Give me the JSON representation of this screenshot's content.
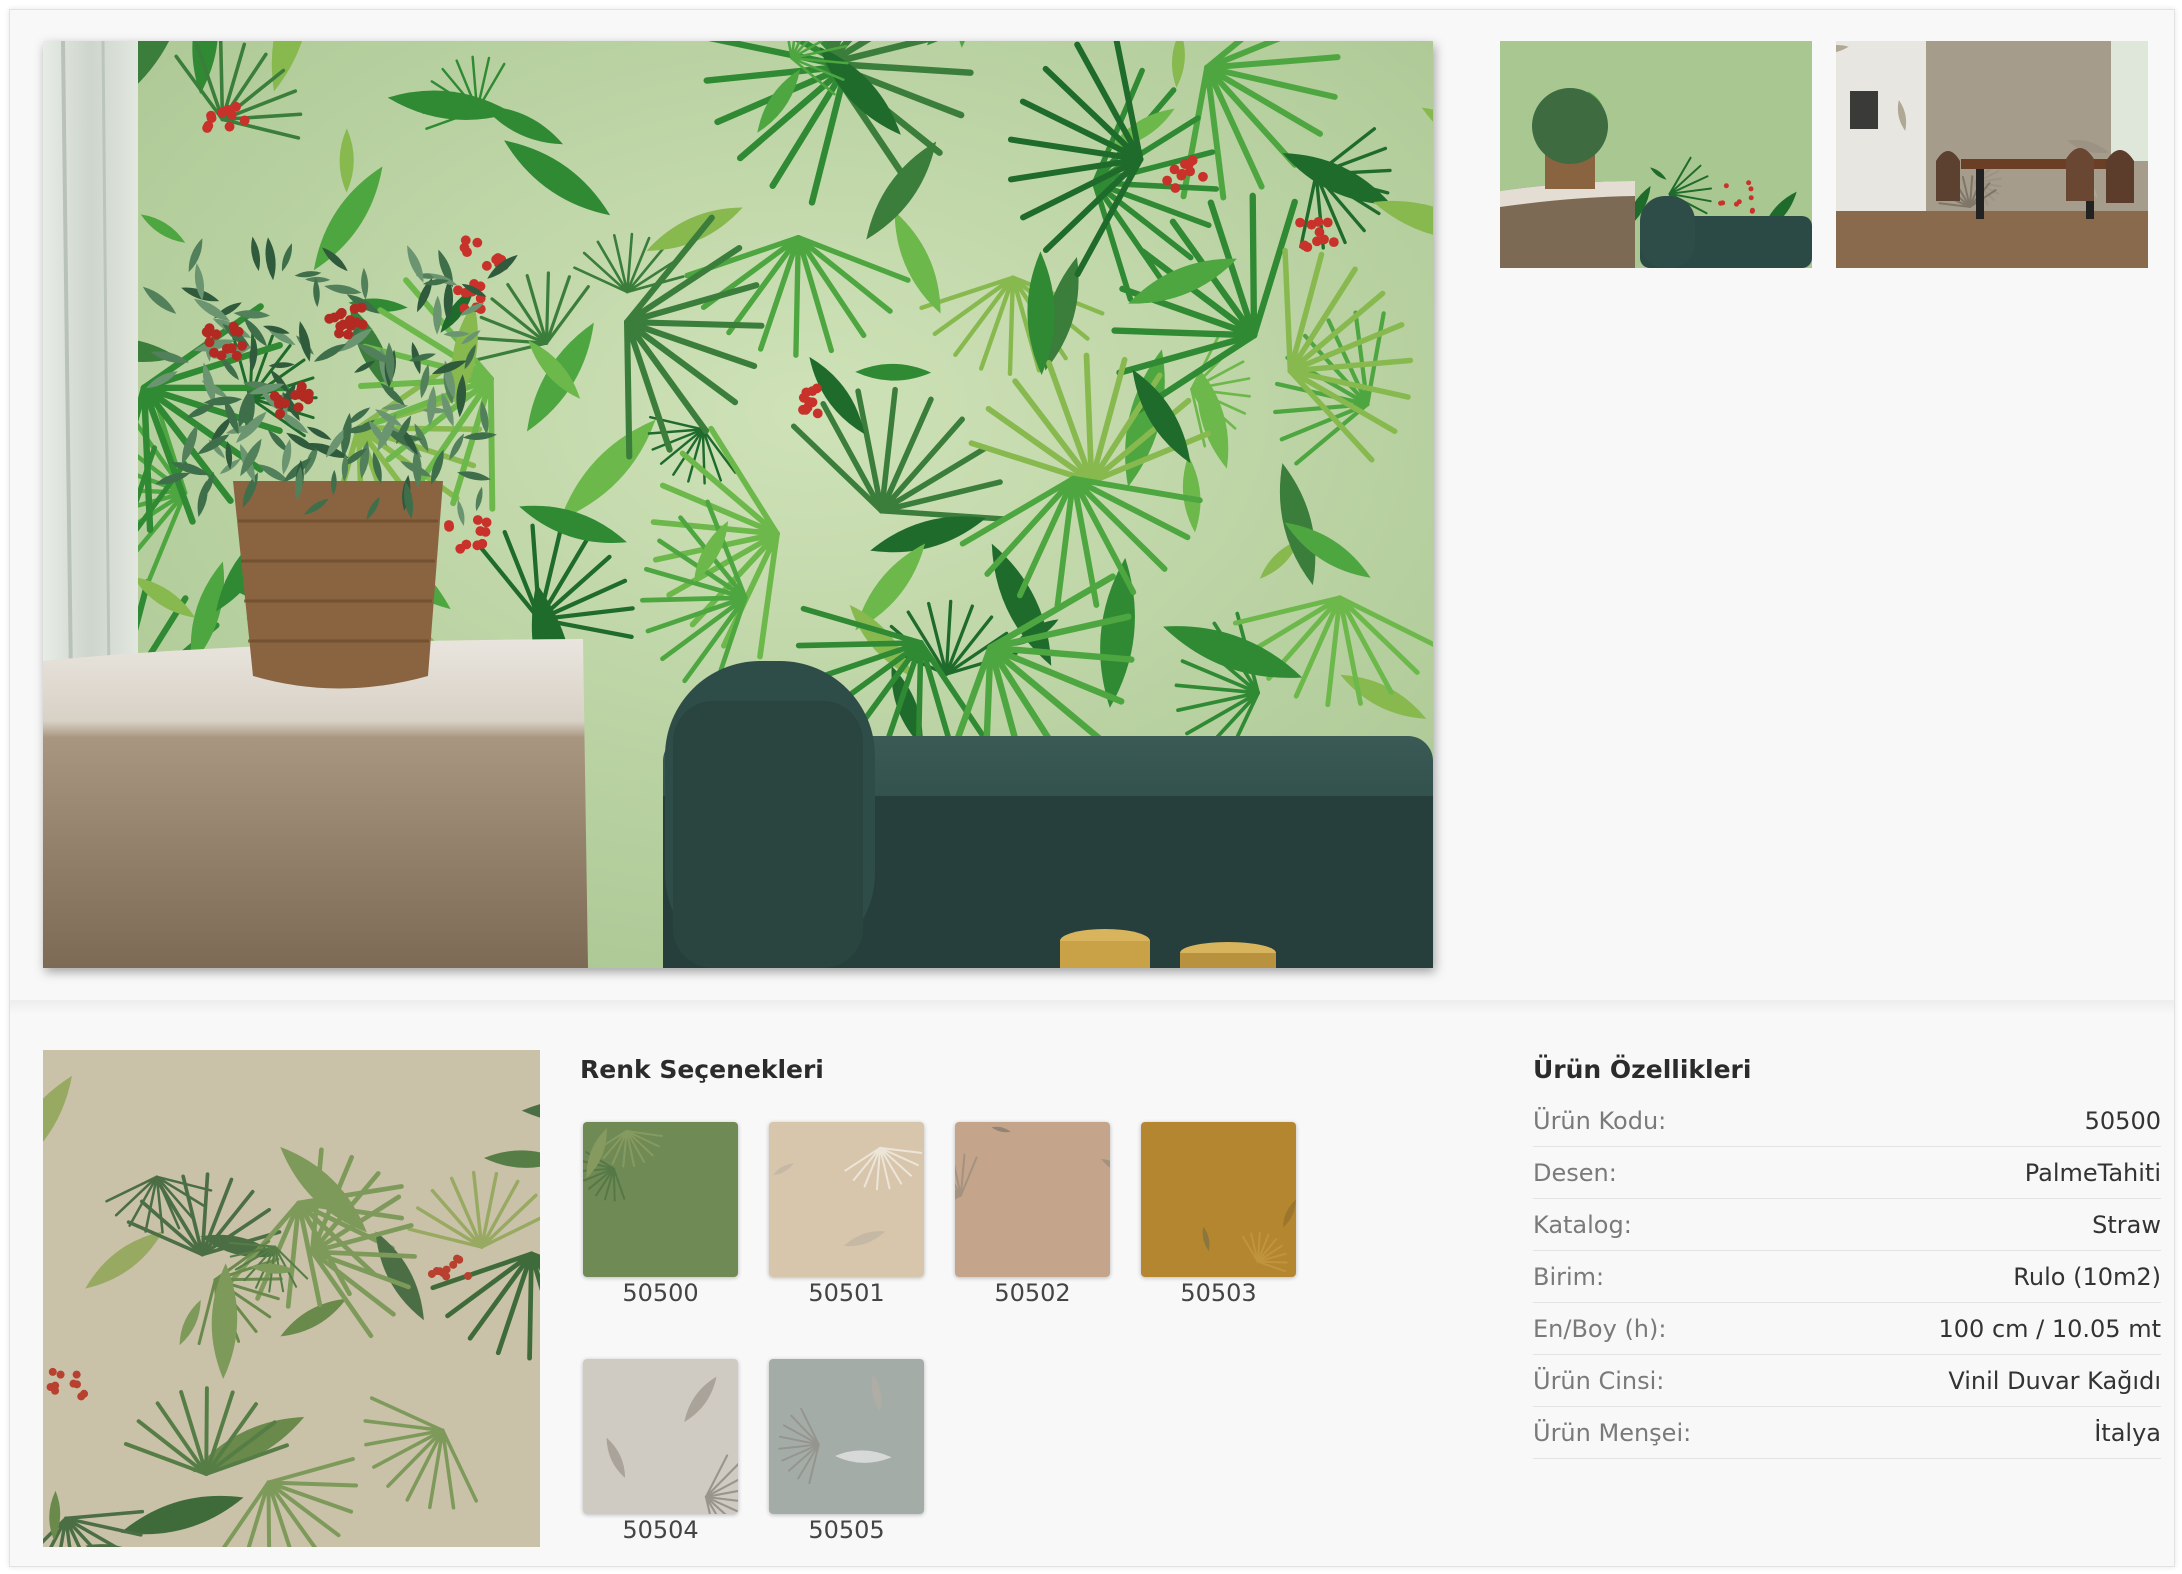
{
  "thumbnails": [
    {
      "alt": "room-scene-1"
    },
    {
      "alt": "room-scene-2"
    }
  ],
  "colors_section": {
    "title": "Renk Seçenekleri",
    "options": [
      {
        "code": "50500",
        "tone": "#6f8a55"
      },
      {
        "code": "50501",
        "tone": "#d7c6ac"
      },
      {
        "code": "50502",
        "tone": "#c4a58b"
      },
      {
        "code": "50503",
        "tone": "#b4862f"
      },
      {
        "code": "50504",
        "tone": "#cfcac2"
      },
      {
        "code": "50505",
        "tone": "#a4aca8"
      }
    ]
  },
  "properties_section": {
    "title": "Ürün Özellikleri",
    "rows": [
      {
        "key": "Ürün Kodu:",
        "value": "50500"
      },
      {
        "key": "Desen:",
        "value": "PalmeTahiti"
      },
      {
        "key": "Katalog:",
        "value": "Straw"
      },
      {
        "key": "Birim:",
        "value": "Rulo (10m2)"
      },
      {
        "key": "En/Boy (h):",
        "value": "100 cm / 10.05 mt"
      },
      {
        "key": "Ürün Cinsi:",
        "value": "Vinil Duvar Kağıdı"
      },
      {
        "key": "Ürün Menşei:",
        "value": "İtalya"
      }
    ]
  },
  "colors": {
    "page_bg": "#f8f8f8",
    "leaf_dark": "#1f6b2c",
    "leaf_mid": "#3f9a3a",
    "wall_bg": "#b9d3a4",
    "sofa": "#2c4a45",
    "berry": "#c8322a"
  }
}
